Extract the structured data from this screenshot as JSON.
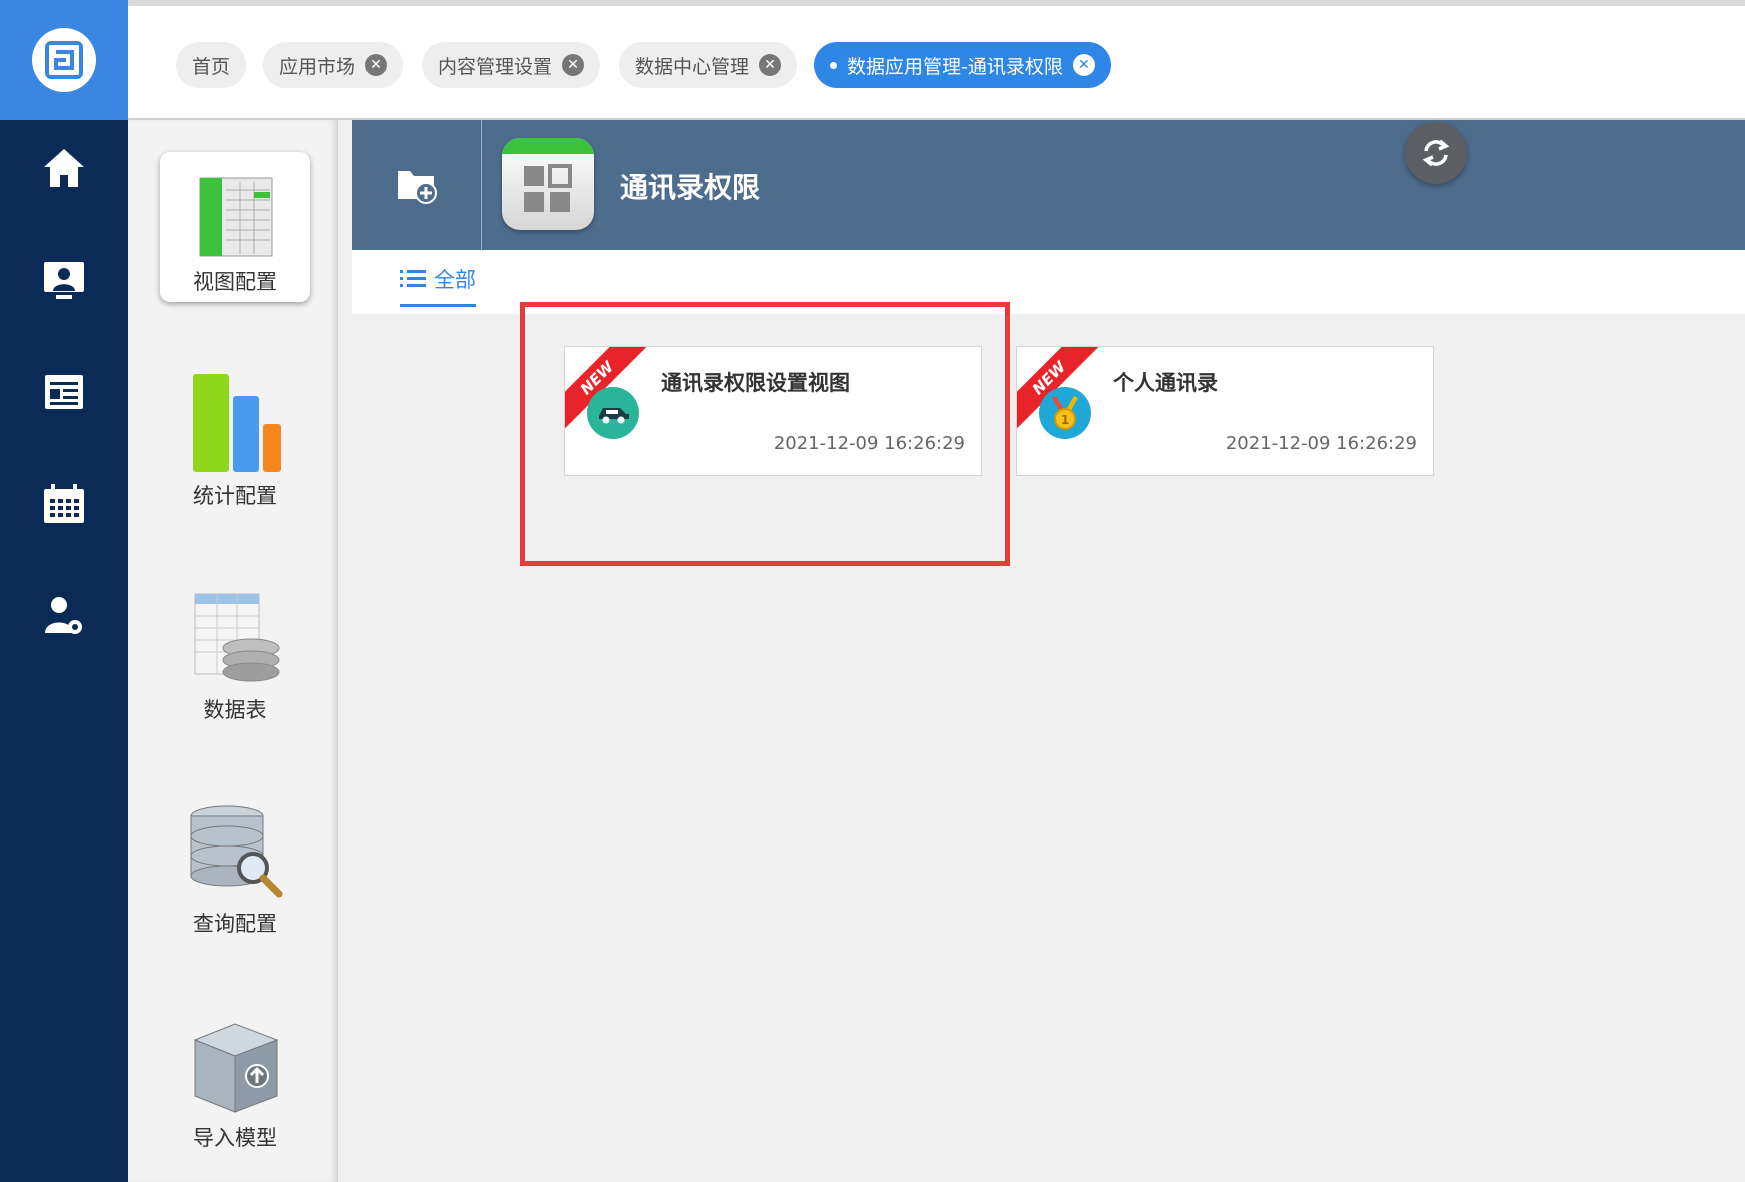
{
  "tabs": [
    {
      "label": "首页",
      "closable": false,
      "active": false
    },
    {
      "label": "应用市场",
      "closable": true,
      "active": false
    },
    {
      "label": "内容管理设置",
      "closable": true,
      "active": false
    },
    {
      "label": "数据中心管理",
      "closable": true,
      "active": false
    },
    {
      "label": "数据应用管理-通讯录权限",
      "closable": true,
      "active": true
    }
  ],
  "tab_close_glyph": "✕",
  "rail": {
    "icons": [
      "home-icon",
      "monitor-user-icon",
      "news-icon",
      "calendar-icon",
      "user-settings-icon"
    ]
  },
  "config_menu": [
    {
      "label": "视图配置",
      "icon": "view-config-icon",
      "selected": true
    },
    {
      "label": "统计配置",
      "icon": "bar-chart-icon",
      "selected": false
    },
    {
      "label": "数据表",
      "icon": "data-table-icon",
      "selected": false
    },
    {
      "label": "查询配置",
      "icon": "database-search-icon",
      "selected": false
    },
    {
      "label": "导入模型",
      "icon": "import-model-icon",
      "selected": false
    }
  ],
  "header": {
    "title": "通讯录权限"
  },
  "filter": {
    "all_label": "全部"
  },
  "cards": [
    {
      "badge": "NEW",
      "title": "通讯录权限设置视图",
      "date": "2021-12-09 16:26:29",
      "icon": "car-icon",
      "icon_color": "#2ab59a"
    },
    {
      "badge": "NEW",
      "title": "个人通讯录",
      "date": "2021-12-09 16:26:29",
      "icon": "medal-icon",
      "icon_color": "#1fa7d6"
    }
  ],
  "colors": {
    "rail": "#0b2a55",
    "accent": "#2e86e6",
    "header": "#4e6c8c",
    "highlight": "#e63b3b",
    "new_ribbon": "#e8242a"
  }
}
